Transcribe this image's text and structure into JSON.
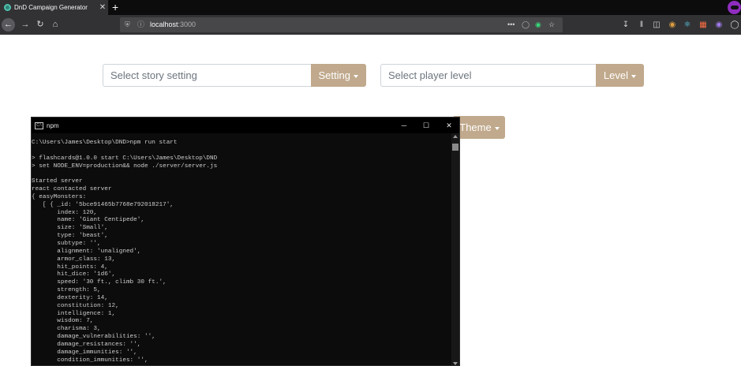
{
  "browser": {
    "tab_title": "DnD Campaign Generator",
    "tab_close": "✕",
    "new_tab": "+",
    "url_host": "localhost",
    "url_port": ":3000",
    "nav_icons": [
      "back-arrow-icon",
      "forward-arrow-icon",
      "reload-icon",
      "home-icon"
    ],
    "toolbar_icons": [
      "download-icon",
      "library-icon",
      "sidebar-icon",
      "extension-icon",
      "react-devtools-icon",
      "extension-icon",
      "redux-devtools-icon",
      "account-icon",
      "menu-icon"
    ],
    "accent": "#8f2dbf"
  },
  "page": {
    "setting": {
      "placeholder": "Select story setting",
      "button": "Setting"
    },
    "level": {
      "placeholder": "Select player level",
      "button": "Level"
    },
    "theme": {
      "button": "Theme"
    },
    "button_color": "#c0a98c"
  },
  "terminal": {
    "title": "npm",
    "icon_label": "C:\\",
    "controls": {
      "minimize": "─",
      "maximize": "☐",
      "close": "✕"
    },
    "lines": [
      "C:\\Users\\James\\Desktop\\DND>npm run start",
      "",
      "> flashcards@1.0.0 start C:\\Users\\James\\Desktop\\DND",
      "> set NODE_ENV=production&& node ./server/server.js",
      "",
      "Started server",
      "react contacted server",
      "{ easyMonsters:",
      "   [ { _id: '5bce91465b7768e792018217',",
      "       index: 120,",
      "       name: 'Giant Centipede',",
      "       size: 'Small',",
      "       type: 'beast',",
      "       subtype: '',",
      "       alignment: 'unaligned',",
      "       armor_class: 13,",
      "       hit_points: 4,",
      "       hit_dice: '1d6',",
      "       speed: '30 ft., climb 30 ft.',",
      "       strength: 5,",
      "       dexterity: 14,",
      "       constitution: 12,",
      "       intelligence: 1,",
      "       wisdom: 7,",
      "       charisma: 3,",
      "       damage_vulnerabilities: '',",
      "       damage_resistances: '',",
      "       damage_immunities: '',",
      "       condition_immunities: '',"
    ]
  }
}
